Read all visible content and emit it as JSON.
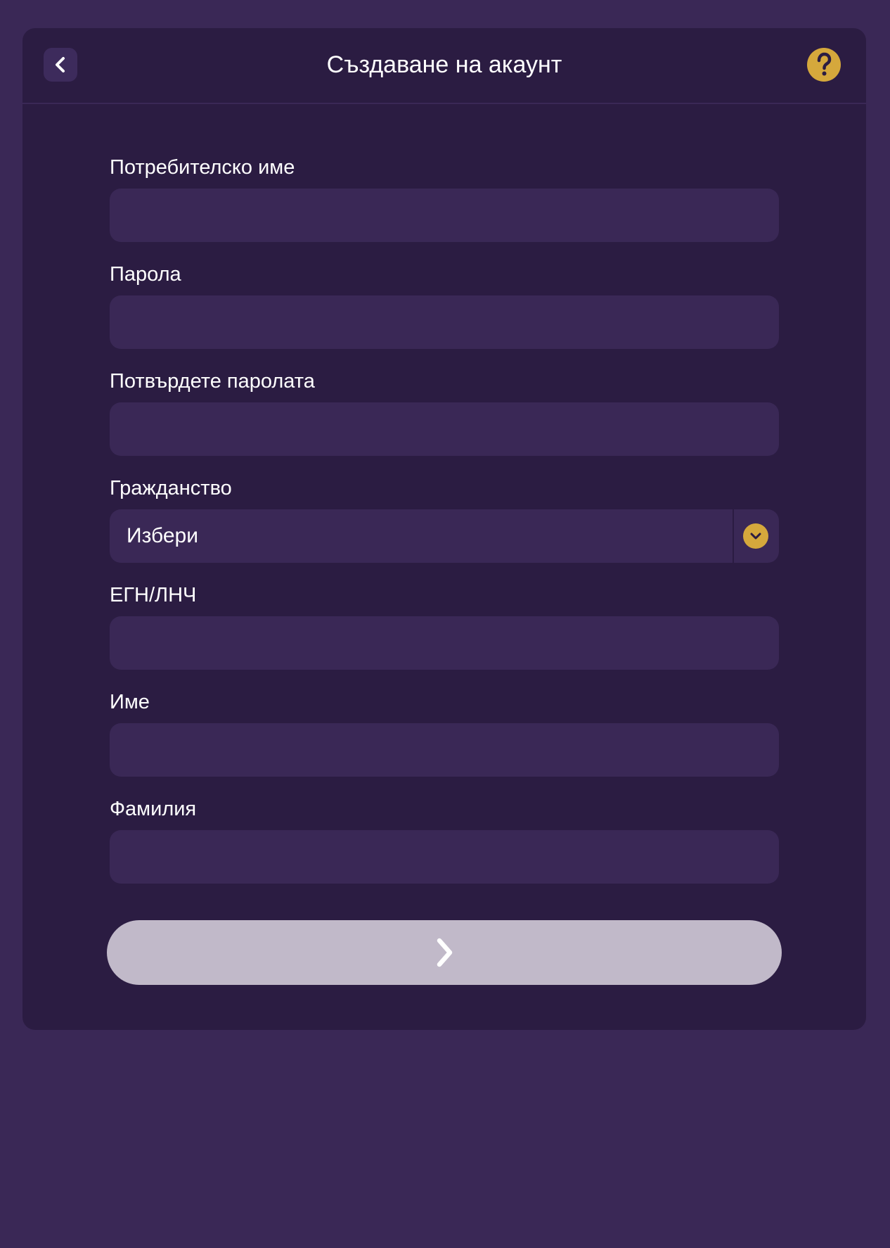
{
  "header": {
    "title": "Създаване на акаунт",
    "back_icon": "chevron-left-icon",
    "help_icon": "question-mark-icon"
  },
  "form": {
    "username": {
      "label": "Потребителско име",
      "value": ""
    },
    "password": {
      "label": "Парола",
      "value": ""
    },
    "confirm_password": {
      "label": "Потвърдете паролата",
      "value": ""
    },
    "citizenship": {
      "label": "Гражданство",
      "selected": "Избери"
    },
    "egn": {
      "label": "ЕГН/ЛНЧ",
      "value": ""
    },
    "first_name": {
      "label": "Име",
      "value": ""
    },
    "last_name": {
      "label": "Фамилия",
      "value": ""
    }
  },
  "submit": {
    "icon": "chevron-right-icon"
  },
  "colors": {
    "page_background": "#3a2856",
    "card_background": "#2b1c42",
    "input_background": "#3a2856",
    "accent": "#d5a83c",
    "button_disabled": "#c1b9c9",
    "text": "#ffffff"
  }
}
